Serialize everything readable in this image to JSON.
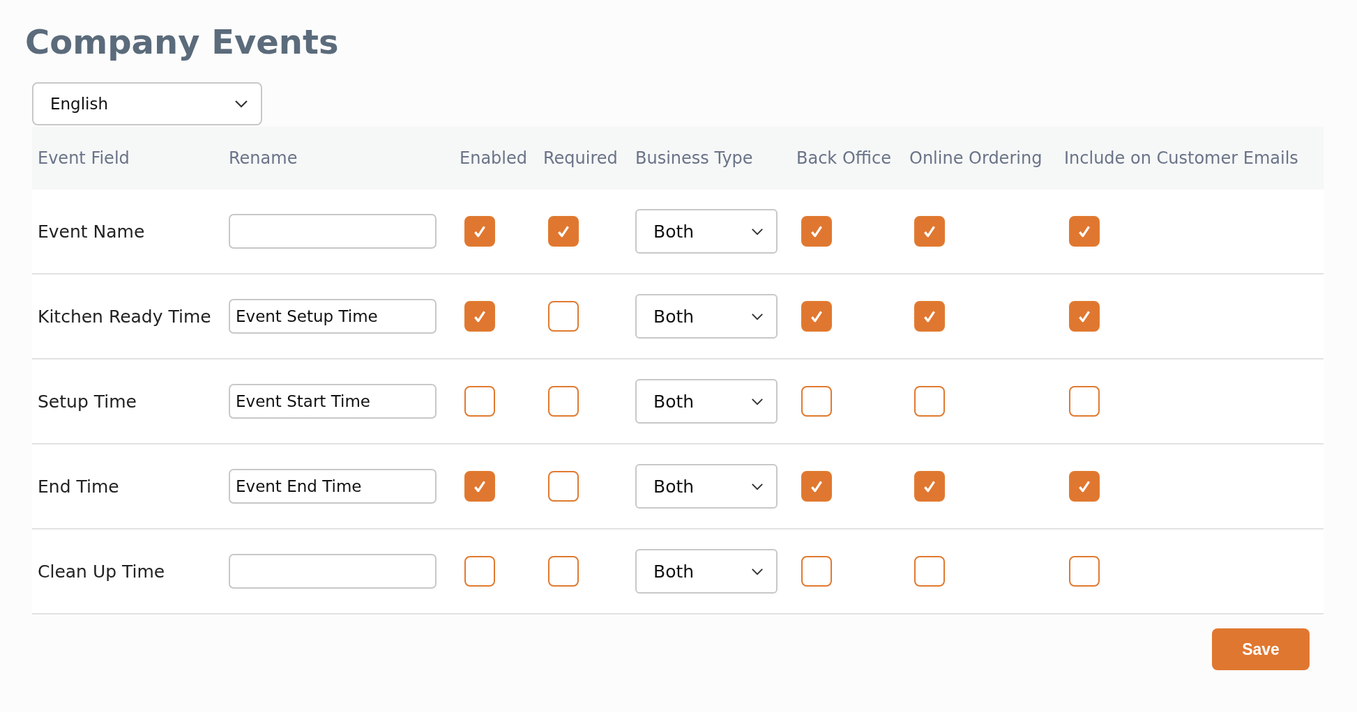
{
  "title": "Company Events",
  "language": "English",
  "columns": [
    "Event Field",
    "Rename",
    "Enabled",
    "Required",
    "Business Type",
    "Back Office",
    "Online Ordering",
    "Include on Customer Emails"
  ],
  "rows": [
    {
      "field": "Event Name",
      "enabled": true,
      "required": true,
      "business_type": "Both",
      "back_office": true,
      "online_ordering": true,
      "customer_emails": true
    },
    {
      "field": "Kitchen Ready Time",
      "rename": "Event Setup Time",
      "enabled": true,
      "required": false,
      "business_type": "Both",
      "back_office": true,
      "online_ordering": true,
      "customer_emails": true
    },
    {
      "field": "Setup Time",
      "rename": "Event Start Time",
      "enabled": false,
      "required": false,
      "business_type": "Both",
      "back_office": false,
      "online_ordering": false,
      "customer_emails": false
    },
    {
      "field": "End Time",
      "rename": "Event End Time",
      "enabled": true,
      "required": false,
      "business_type": "Both",
      "back_office": true,
      "online_ordering": true,
      "customer_emails": true
    },
    {
      "field": "Clean Up Time",
      "enabled": false,
      "required": false,
      "business_type": "Both",
      "back_office": false,
      "online_ordering": false,
      "customer_emails": false
    }
  ],
  "save_button": "Save"
}
